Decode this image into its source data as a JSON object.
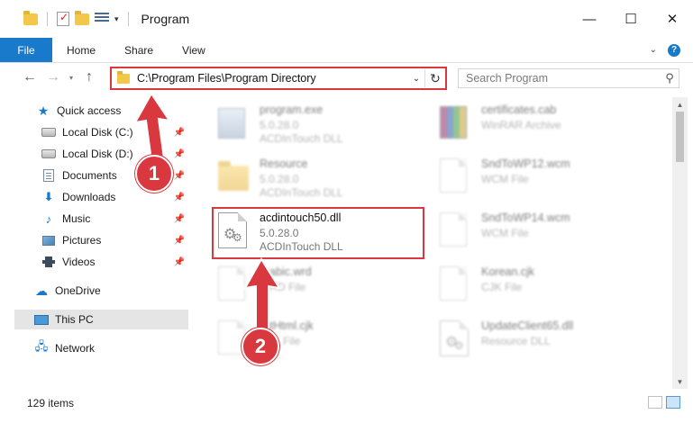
{
  "window": {
    "title": "Program",
    "controls": {
      "minimize": "—",
      "maximize": "☐",
      "close": "✕"
    }
  },
  "ribbon": {
    "tabs": [
      "File",
      "Home",
      "Share",
      "View"
    ]
  },
  "address": {
    "path": "C:\\Program Files\\Program Directory"
  },
  "search": {
    "placeholder": "Search Program"
  },
  "sidebar": {
    "items": [
      {
        "label": "Quick access",
        "icon": "star-icon"
      },
      {
        "label": "Local Disk (C:)",
        "icon": "drive-icon",
        "pinned": true
      },
      {
        "label": "Local Disk (D:)",
        "icon": "drive-icon",
        "pinned": true
      },
      {
        "label": "Documents",
        "icon": "documents-icon",
        "pinned": true
      },
      {
        "label": "Downloads",
        "icon": "download-icon",
        "pinned": true
      },
      {
        "label": "Music",
        "icon": "music-icon",
        "pinned": true
      },
      {
        "label": "Pictures",
        "icon": "pictures-icon",
        "pinned": true
      },
      {
        "label": "Videos",
        "icon": "videos-icon",
        "pinned": true
      },
      {
        "label": "OneDrive",
        "icon": "cloud-icon"
      },
      {
        "label": "This PC",
        "icon": "computer-icon",
        "selected": true
      },
      {
        "label": "Network",
        "icon": "network-icon"
      }
    ]
  },
  "files": [
    {
      "name": "program.exe",
      "line2": "5.0.28.0",
      "line3": "ACDInTouch DLL",
      "icon": "exe-icon"
    },
    {
      "name": "certificates.cab",
      "line2": "WinRAR Archive",
      "line3": "",
      "icon": "rar-icon"
    },
    {
      "name": "Resource",
      "line2": "5.0.28.0",
      "line3": "ACDInTouch DLL",
      "icon": "folder-icon"
    },
    {
      "name": "SndToWP12.wcm",
      "line2": "WCM File",
      "line3": "",
      "icon": "file-icon"
    },
    {
      "name": "acdintouch50.dll",
      "line2": "5.0.28.0",
      "line3": "ACDInTouch DLL",
      "icon": "dll-gear-icon"
    },
    {
      "name": "SndToWP14.wcm",
      "line2": "WCM File",
      "line3": "",
      "icon": "file-icon"
    },
    {
      "name": "arabic.wrd",
      "line2": "WRD File",
      "line3": "",
      "icon": "file-icon"
    },
    {
      "name": "Korean.cjk",
      "line2": "CJK File",
      "line3": "",
      "icon": "file-icon"
    },
    {
      "name": "listHtml.cjk",
      "line2": "CJK File",
      "line3": "",
      "icon": "file-icon"
    },
    {
      "name": "UpdateClient65.dll",
      "line2": "Resource DLL",
      "line3": "",
      "icon": "dll-gear-icon"
    }
  ],
  "callouts": {
    "step1": "1",
    "step2": "2"
  },
  "status": {
    "items": "129 items"
  },
  "colors": {
    "accent": "#1979ca",
    "highlight": "#d9393e"
  }
}
